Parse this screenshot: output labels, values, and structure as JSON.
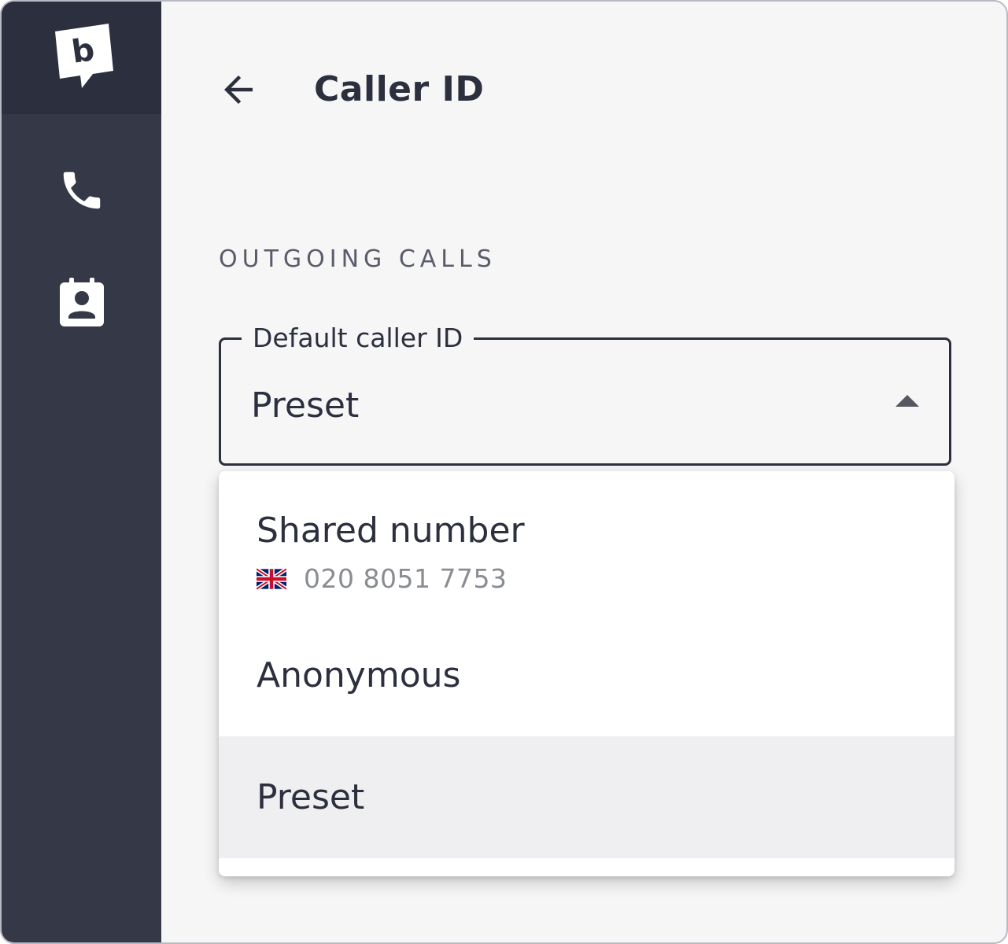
{
  "page": {
    "title": "Caller ID",
    "section_label": "OUTGOING CALLS"
  },
  "sidebar": {
    "logo_letter": "b",
    "nav": [
      {
        "icon": "phone-icon"
      },
      {
        "icon": "contacts-icon"
      }
    ]
  },
  "select": {
    "label": "Default caller ID",
    "value": "Preset",
    "expanded": true
  },
  "options": [
    {
      "label": "Shared number",
      "sub": "020 8051 7753",
      "flag": "uk-flag-icon",
      "selected": false
    },
    {
      "label": "Anonymous",
      "selected": false
    },
    {
      "label": "Preset",
      "selected": true
    }
  ],
  "colors": {
    "sidebar": "#353847",
    "sidebar_header": "#2c2f3d",
    "text_primary": "#2c2f3d",
    "text_secondary": "#8a8c94",
    "page_bg": "#f6f6f7",
    "selected_bg": "#efeff1"
  }
}
